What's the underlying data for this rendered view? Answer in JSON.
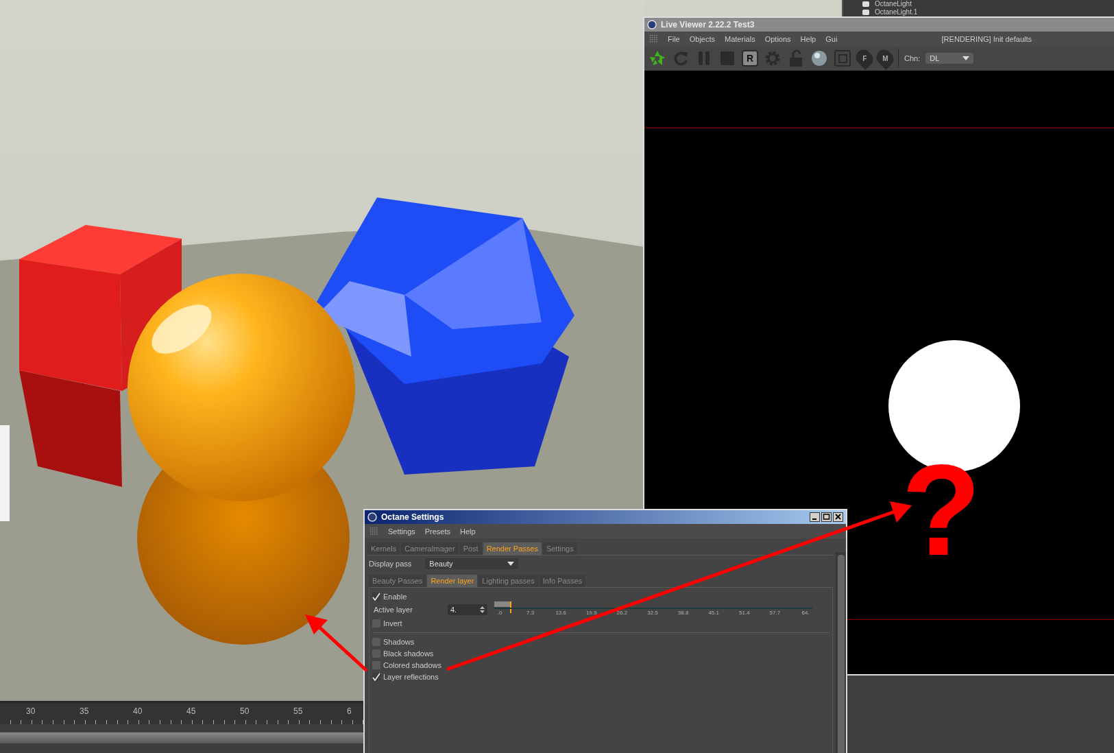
{
  "viewport": {
    "timeline": {
      "ticks": [
        "30",
        "35",
        "40",
        "45",
        "50",
        "55",
        "6"
      ]
    }
  },
  "object_manager": {
    "items": [
      {
        "name": "OctaneLight"
      },
      {
        "name": "OctaneLight.1"
      }
    ]
  },
  "live_viewer": {
    "title": "Live Viewer 2.22.2 Test3",
    "menu": [
      "File",
      "Objects",
      "Materials",
      "Options",
      "Help",
      "Gui"
    ],
    "status": "[RENDERING] Init defaults",
    "toolbar": [
      {
        "kind": "aperture"
      },
      {
        "kind": "refresh"
      },
      {
        "kind": "pause"
      },
      {
        "kind": "stop"
      },
      {
        "kind": "letterbox",
        "letter": "R"
      },
      {
        "kind": "gear"
      },
      {
        "kind": "lock"
      },
      {
        "kind": "sphere"
      },
      {
        "kind": "frame"
      },
      {
        "kind": "pin",
        "letter": "F"
      },
      {
        "kind": "pin",
        "letter": "M"
      }
    ],
    "channel": {
      "label": "Chn:",
      "value": "DL"
    },
    "annotation": "?"
  },
  "octane_settings": {
    "title": "Octane Settings",
    "menu": [
      "Settings",
      "Presets",
      "Help"
    ],
    "tabs": [
      {
        "label": "Kernels",
        "selected": false
      },
      {
        "label": "CameraImager",
        "selected": false
      },
      {
        "label": "Post",
        "selected": false
      },
      {
        "label": "Render Passes",
        "selected": true
      },
      {
        "label": "Settings",
        "selected": false
      }
    ],
    "display_pass": {
      "label": "Display pass",
      "value": "Beauty"
    },
    "subtabs": [
      {
        "label": "Beauty Passes",
        "selected": false
      },
      {
        "label": "Render layer",
        "selected": true
      },
      {
        "label": "Lighting passes",
        "selected": false
      },
      {
        "label": "Info Passes",
        "selected": false
      }
    ],
    "enable": {
      "label": "Enable",
      "checked": true
    },
    "active_layer": {
      "label": "Active layer",
      "value": "4.",
      "level": 0.05,
      "ticks": [
        ".0",
        "7.3",
        "13.6",
        "19.9",
        "26.2",
        "32.5",
        "38.8",
        "45.1",
        "51.4",
        "57.7",
        "64."
      ]
    },
    "invert": {
      "label": "Invert",
      "checked": false
    },
    "options": [
      {
        "label": "Shadows",
        "checked": false
      },
      {
        "label": "Black shadows",
        "checked": false
      },
      {
        "label": "Colored shadows",
        "checked": false
      },
      {
        "label": "Layer reflections",
        "checked": true
      }
    ]
  }
}
